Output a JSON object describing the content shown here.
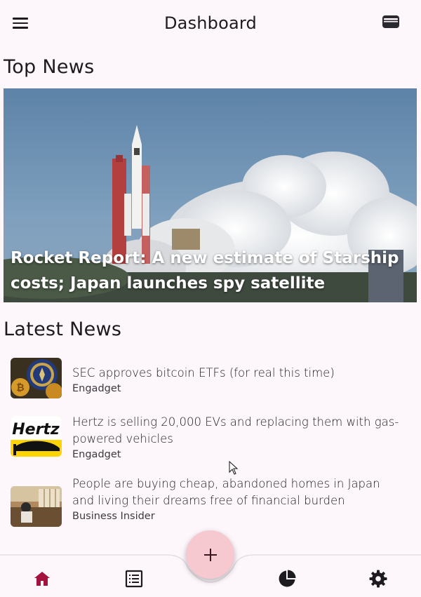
{
  "appbar": {
    "title": "Dashboard",
    "menu_icon": "menu-icon",
    "wallet_icon": "wallet-icon"
  },
  "top_news": {
    "section_title": "Top News",
    "headline": "Rocket Report: A new estimate of Starship costs; Japan launches spy satellite"
  },
  "latest_news": {
    "section_title": "Latest News",
    "items": [
      {
        "headline": "SEC approves bitcoin ETFs (for real this time)",
        "source": "Engadget",
        "thumb_icon": "sec-bitcoin-thumbnail"
      },
      {
        "headline": "Hertz is selling 20,000 EVs and replacing them with gas-powered vehicles",
        "source": "Engadget",
        "thumb_icon": "hertz-thumbnail",
        "thumb_text": "Hertz"
      },
      {
        "headline": "People are buying cheap, abandoned homes in Japan and living their dreams free of financial burden",
        "source": "Business Insider",
        "thumb_icon": "japan-home-thumbnail"
      }
    ]
  },
  "bottom_nav": {
    "items": [
      {
        "icon": "home-icon",
        "active": true
      },
      {
        "icon": "list-icon",
        "active": false
      },
      {
        "icon": "pie-chart-icon",
        "active": false
      },
      {
        "icon": "settings-icon",
        "active": false
      }
    ],
    "fab_icon": "plus-icon"
  },
  "colors": {
    "background": "#fdf7fb",
    "active_nav": "#a4123f",
    "fab": "#f6c9d1",
    "text": "#1d1b20"
  }
}
